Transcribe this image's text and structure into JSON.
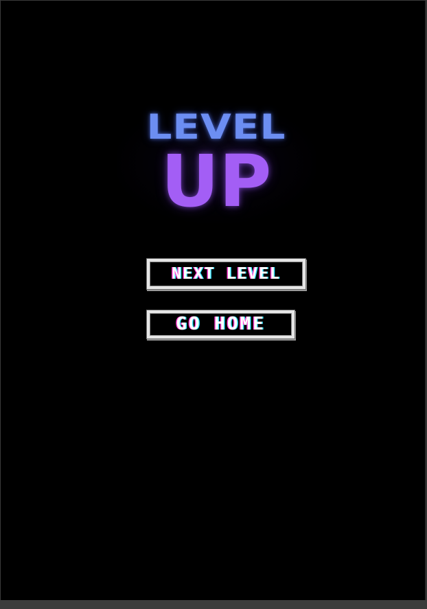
{
  "title": {
    "line1": "LEVEL",
    "line2": "UP"
  },
  "buttons": {
    "next_level": "NEXT LEVEL",
    "go_home": "GO HOME"
  },
  "colors": {
    "background": "#000000",
    "title_line1": "#6c8ef2",
    "title_line2": "#a35ef5",
    "button_border": "#e6e6e6",
    "button_text": "#ffffff",
    "text_shadow_magenta": "#ff3fd0",
    "text_shadow_cyan": "#35e6ff"
  }
}
